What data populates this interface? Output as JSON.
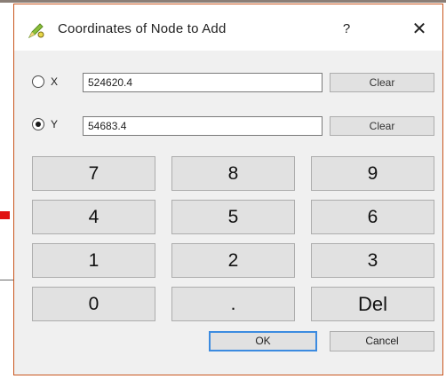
{
  "window": {
    "title": "Coordinates of Node to Add",
    "help_label": "?",
    "close_label": "✕",
    "icon": "pencil-node-icon"
  },
  "coordinates": {
    "x": {
      "label": "X",
      "value": "524620.4",
      "selected": false,
      "clear_label": "Clear"
    },
    "y": {
      "label": "Y",
      "value": "54683.4",
      "selected": true,
      "clear_label": "Clear"
    }
  },
  "keypad": {
    "keys": [
      "7",
      "8",
      "9",
      "4",
      "5",
      "6",
      "1",
      "2",
      "3",
      "0",
      ".",
      "Del"
    ]
  },
  "buttons": {
    "ok_label": "OK",
    "cancel_label": "Cancel"
  },
  "colors": {
    "dialog_border": "#c8551d",
    "focus_border": "#3c8be0",
    "marker": "#e01111"
  }
}
